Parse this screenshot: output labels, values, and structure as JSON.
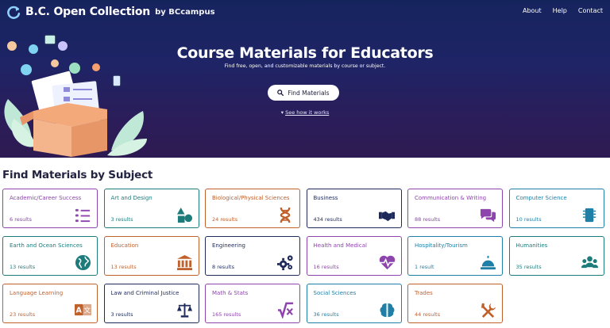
{
  "header": {
    "brand_name": "B.C. Open Collection",
    "brand_by": "by BCcampus",
    "nav": [
      {
        "label": "About"
      },
      {
        "label": "Help"
      },
      {
        "label": "Contact"
      }
    ]
  },
  "hero": {
    "title": "Course Materials for Educators",
    "subtitle": "Find free, open, and customizable materials by course or subject.",
    "button_label": "Find Materials",
    "link_label": "See how it works"
  },
  "subjects": {
    "heading": "Find Materials by Subject",
    "items": [
      {
        "title": "Academic/Career Success",
        "count": "6 results",
        "icon": "checklist-icon",
        "color": "#8e44ad"
      },
      {
        "title": "Art and Design",
        "count": "3 results",
        "icon": "shapes-icon",
        "color": "#1d7b7b"
      },
      {
        "title": "Biological/Physical Sciences",
        "count": "24 results",
        "icon": "dna-icon",
        "color": "#c0602b"
      },
      {
        "title": "Business",
        "count": "434 results",
        "icon": "handshake-icon",
        "color": "#1e2a5a"
      },
      {
        "title": "Communication & Writing",
        "count": "88 results",
        "icon": "chat-bubbles-icon",
        "color": "#8e44ad"
      },
      {
        "title": "Computer Science",
        "count": "10 results",
        "icon": "microchip-icon",
        "color": "#1f7fa6"
      },
      {
        "title": "Earth and Ocean Sciences",
        "count": "13 results",
        "icon": "globe-icon",
        "color": "#1d7b7b"
      },
      {
        "title": "Education",
        "count": "13 results",
        "icon": "school-building-icon",
        "color": "#c0602b"
      },
      {
        "title": "Engineering",
        "count": "8 results",
        "icon": "gears-icon",
        "color": "#1e2a5a"
      },
      {
        "title": "Health and Medical",
        "count": "16 results",
        "icon": "heartbeat-icon",
        "color": "#8e44ad"
      },
      {
        "title": "Hospitality/Tourism",
        "count": "1 result",
        "icon": "service-bell-icon",
        "color": "#1f7fa6"
      },
      {
        "title": "Humanities",
        "count": "35 results",
        "icon": "people-group-icon",
        "color": "#1d7b7b"
      },
      {
        "title": "Language Learning",
        "count": "23 results",
        "icon": "language-icon",
        "color": "#c0602b"
      },
      {
        "title": "Law and Criminal Justice",
        "count": "3 results",
        "icon": "scales-icon",
        "color": "#1e2a5a"
      },
      {
        "title": "Math & Stats",
        "count": "165 results",
        "icon": "square-root-icon",
        "color": "#8e44ad"
      },
      {
        "title": "Social Sciences",
        "count": "36 results",
        "icon": "brain-icon",
        "color": "#1f7fa6"
      },
      {
        "title": "Trades",
        "count": "44 results",
        "icon": "tools-icon",
        "color": "#c0602b"
      }
    ]
  },
  "colors": {
    "hero_top": "#16245e",
    "hero_bottom": "#2e1a52",
    "purple": "#8e44ad",
    "teal": "#1d7b7b",
    "orange": "#c0602b",
    "navy": "#1e2a5a",
    "blue": "#1f7fa6"
  }
}
